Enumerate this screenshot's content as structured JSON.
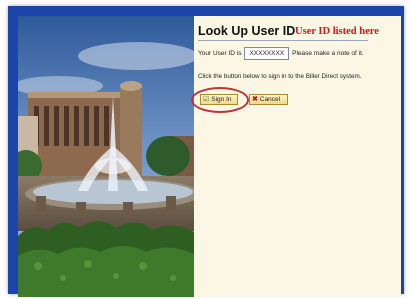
{
  "page": {
    "title": "Look Up User ID",
    "annotation": "User ID listed here"
  },
  "userid": {
    "prefix": "Your User ID is",
    "value": "XXXXXXXX",
    "suffix": "Please make a note of it."
  },
  "instructions": "Click the button below to sign in to the Biller Direct system.",
  "buttons": {
    "sign_in": "Sign In",
    "cancel": "Cancel"
  },
  "colors": {
    "annotation": "#d8141b",
    "highlight_ring": "#c23338",
    "frame": "#1b45a8"
  }
}
